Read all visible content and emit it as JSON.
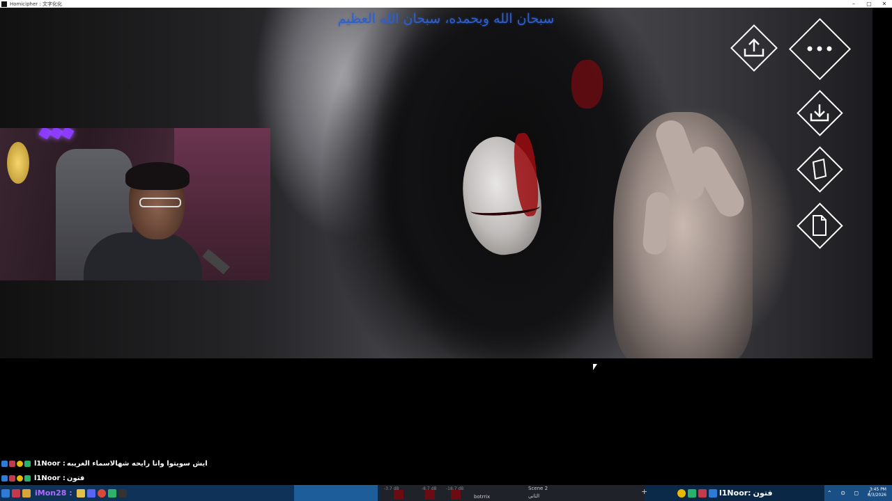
{
  "window": {
    "title": "Homicipher : 文字化化",
    "controls": [
      "–",
      "▢",
      "✕"
    ]
  },
  "overlay": {
    "dhikr_text": "سبحان الله وبحمده، سبحان الله العظيم"
  },
  "game_ui": {
    "buttons": [
      {
        "name": "share-button",
        "icon": "upload-icon"
      },
      {
        "name": "more-options-button",
        "icon": "ellipsis-icon"
      },
      {
        "name": "save-button",
        "icon": "download-icon"
      },
      {
        "name": "notebook-button",
        "icon": "notebook-icon"
      },
      {
        "name": "document-button",
        "icon": "document-icon"
      }
    ]
  },
  "chat": {
    "messages": [
      {
        "user": "l1Noor :",
        "text": "ايش سويتوا وانا رايحه شهالاسماء الغريبه"
      },
      {
        "user": "l1Noor :",
        "text": "فتون"
      }
    ]
  },
  "taskbar": {
    "chat_user": "iMon28 :",
    "obs": {
      "meter_1": "-3.7 dB",
      "meter_2": "-8.7 dB",
      "meter_3": "-18.7 dB",
      "scene": "Scene 2",
      "scene_sub": "الثاني",
      "source": "botrrix"
    },
    "right_chat": {
      "user": "l1Noor:",
      "text": "فتون"
    },
    "clock": {
      "time": "3:45 PM",
      "date": "8/3/2026"
    }
  },
  "colors": {
    "overlay_text": "#2f5fc9",
    "chat_user_purple": "#b06cff",
    "taskbar_bg": "#0b2a4a"
  }
}
